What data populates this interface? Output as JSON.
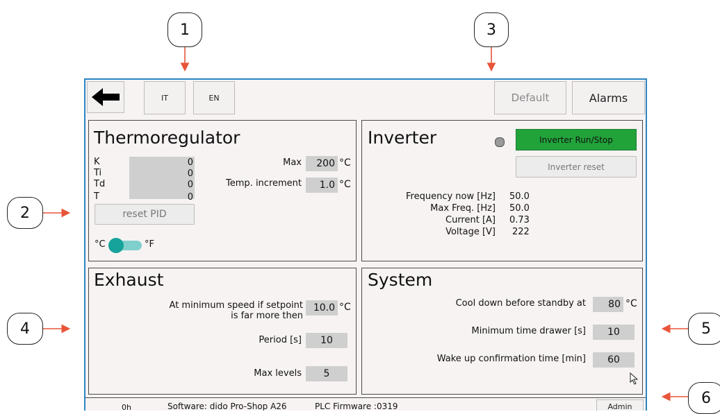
{
  "callouts": [
    "1",
    "2",
    "3",
    "4",
    "5",
    "6"
  ],
  "toolbar": {
    "back_icon": "arrow-left-icon",
    "it": "IT",
    "en": "EN",
    "default": "Default",
    "alarms": "Alarms"
  },
  "thermo": {
    "title": "Thermoregulator",
    "pid": [
      {
        "label": "K",
        "value": "0"
      },
      {
        "label": "Ti",
        "value": "0"
      },
      {
        "label": "Td",
        "value": "0"
      },
      {
        "label": "T",
        "value": "0"
      }
    ],
    "max_label": "Max",
    "max_value": "200",
    "max_unit": "°C",
    "inc_label": "Temp. increment",
    "inc_value": "1.0",
    "inc_unit": "°C",
    "reset": "reset PID",
    "unit_c": "°C",
    "unit_f": "°F"
  },
  "inverter": {
    "title": "Inverter",
    "run": "Inverter Run/Stop",
    "reset": "Inverter reset",
    "rows": [
      {
        "label": "Frequency now [Hz]",
        "value": "50.0"
      },
      {
        "label": "Max Freq. [Hz]",
        "value": "50.0"
      },
      {
        "label": "Current [A]",
        "value": "0.73"
      },
      {
        "label": "Voltage [V]",
        "value": "222"
      }
    ],
    "colors": {
      "run_bg": "#22a33a",
      "led": "#9a9a9a"
    }
  },
  "exhaust": {
    "title": "Exhaust",
    "min_speed_l1": "At minimum speed if setpoint",
    "min_speed_l2": "is far more then",
    "min_speed_value": "10.0",
    "min_speed_unit": "°C",
    "period_label": "Period [s]",
    "period_value": "10",
    "levels_label": "Max levels",
    "levels_value": "5"
  },
  "system": {
    "title": "System",
    "cool_label": "Cool down before standby at",
    "cool_value": "80",
    "cool_unit": "°C",
    "drawer_label": "Minimum time drawer [s]",
    "drawer_value": "10",
    "wake_label": "Wake up confirmation time [min]",
    "wake_value": "60"
  },
  "status": {
    "hours": "0h",
    "software": "Software: dido Pro-Shop A26",
    "firmware": "PLC Firmware :0319",
    "admin": "Admin"
  },
  "accent": "#2a85c4",
  "arrow_color": "#e8553a"
}
